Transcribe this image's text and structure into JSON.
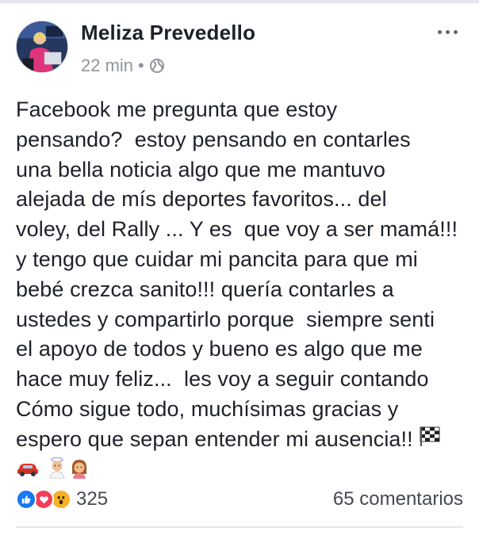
{
  "post": {
    "author": "Meliza Prevedello",
    "time": "22 min",
    "separator": "•",
    "privacy_icon": "globe-icon",
    "more_icon": "more-options-icon",
    "text_lines": [
      "Facebook me pregunta que estoy",
      "pensando?  estoy pensando en contarles",
      "una bella noticia algo que me mantuvo",
      "alejada de mís deportes favoritos... del",
      "voley, del Rally ... Y es  que voy a ser mamá!!!",
      "y tengo que cuidar mi pancita para que mi",
      "bebé crezca sanito!!! quería contarles a",
      "ustedes y compartirlo porque  siempre senti",
      "el apoyo de todos y bueno es algo que me",
      "hace muy feliz...  les voy a seguir contando",
      "Cómo sigue todo, muchísimas gracias y",
      "espero que sepan entender mi ausencia!!"
    ],
    "trailing_emojis": [
      "checkered-flag-icon",
      "red-car-icon",
      "baby-angel-icon",
      "girl-icon"
    ]
  },
  "footer": {
    "reaction_icons": [
      "like-icon",
      "love-icon",
      "wow-icon"
    ],
    "reaction_count": "325",
    "comments_label": "65 comentarios"
  },
  "colors": {
    "like": "#1877f2",
    "love": "#f33e58",
    "wow": "#f7b125",
    "meta_gray": "#90949c",
    "text": "#1d2129"
  }
}
